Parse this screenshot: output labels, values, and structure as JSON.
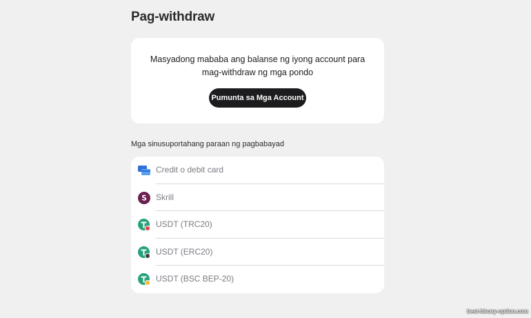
{
  "page": {
    "title": "Pag-withdraw"
  },
  "notice": {
    "message": "Masyadong mababa ang balanse ng iyong account para mag-withdraw ng mga pondo",
    "button_label": "Pumunta sa Mga Account"
  },
  "methods": {
    "label": "Mga sinusuportahang paraan ng pagbabayad",
    "items": [
      {
        "label": "Credit o debit card",
        "icon": "card-icon"
      },
      {
        "label": "Skrill",
        "icon": "skrill-icon"
      },
      {
        "label": "USDT (TRC20)",
        "icon": "usdt-trc20-icon"
      },
      {
        "label": "USDT (ERC20)",
        "icon": "usdt-erc20-icon"
      },
      {
        "label": "USDT (BSC BEP-20)",
        "icon": "usdt-bep20-icon"
      }
    ]
  },
  "watermark": "best-binary-option.com",
  "colors": {
    "background": "#f0f0f0",
    "button": "#1c1c1e",
    "tether": "#26a17b",
    "skrill": "#6a1f4f"
  }
}
